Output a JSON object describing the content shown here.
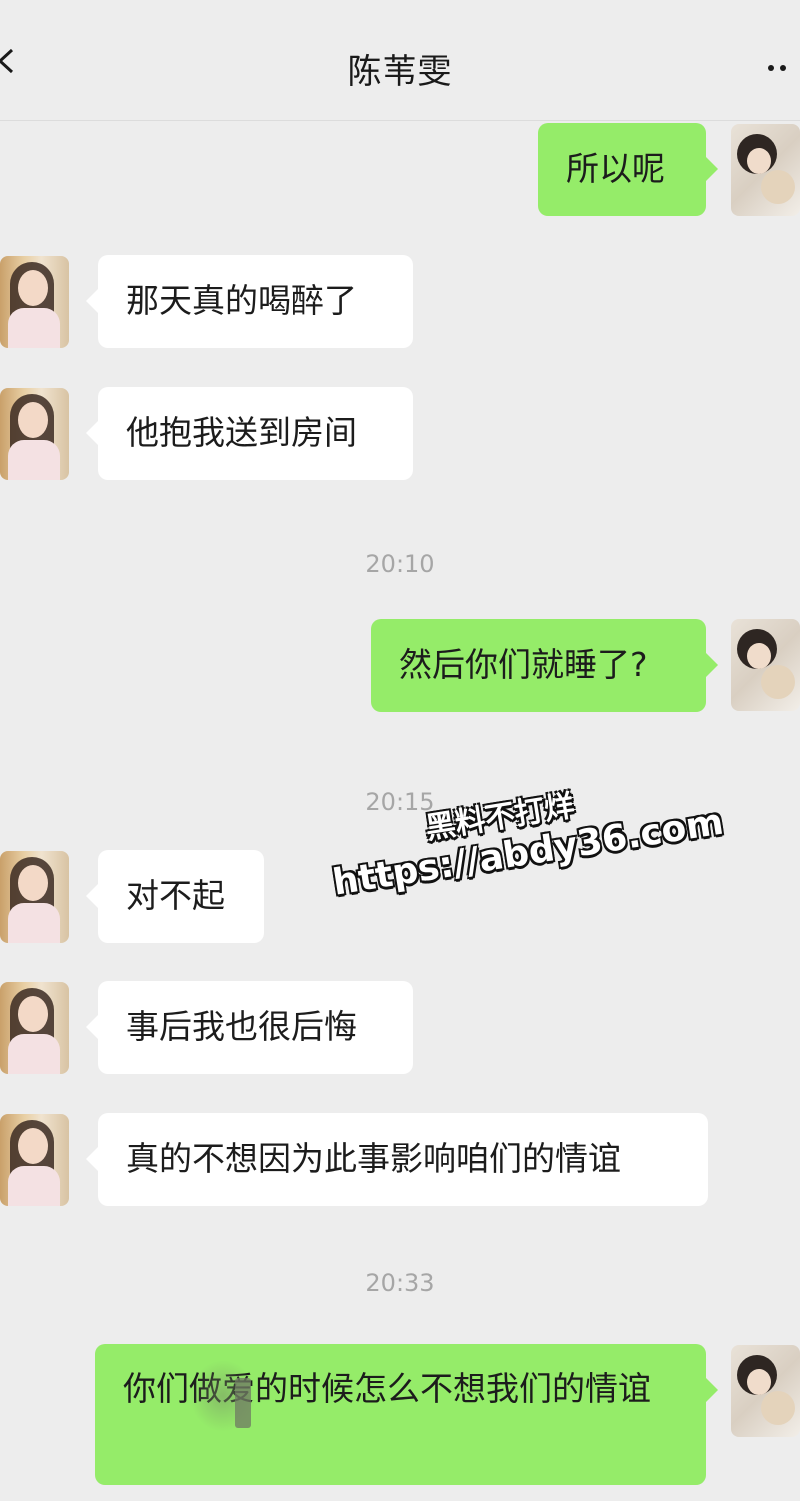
{
  "header": {
    "title": "陈苇雯",
    "back_icon": "chevron-left-icon",
    "more_icon": "more-dots-icon"
  },
  "messages": [
    {
      "side": "out",
      "text": "所以呢"
    },
    {
      "side": "in",
      "text": "那天真的喝醉了"
    },
    {
      "side": "in",
      "text": "他抱我送到房间"
    },
    {
      "side": "time",
      "text": "20:10"
    },
    {
      "side": "out",
      "text": "然后你们就睡了?"
    },
    {
      "side": "time",
      "text": "20:15"
    },
    {
      "side": "in",
      "text": "对不起"
    },
    {
      "side": "in",
      "text": "事后我也很后悔"
    },
    {
      "side": "in",
      "text": "真的不想因为此事影响咱们的情谊"
    },
    {
      "side": "time",
      "text": "20:33"
    },
    {
      "side": "out",
      "text": "你们做爱的时候怎么不想我们的情谊"
    }
  ],
  "watermark": {
    "line1": "黑料不打烊",
    "line2": "https://abdy36.com"
  },
  "colors": {
    "background": "#ededed",
    "outgoing_bubble": "#95ec69",
    "incoming_bubble": "#ffffff",
    "timestamp": "#a6a6a6"
  }
}
